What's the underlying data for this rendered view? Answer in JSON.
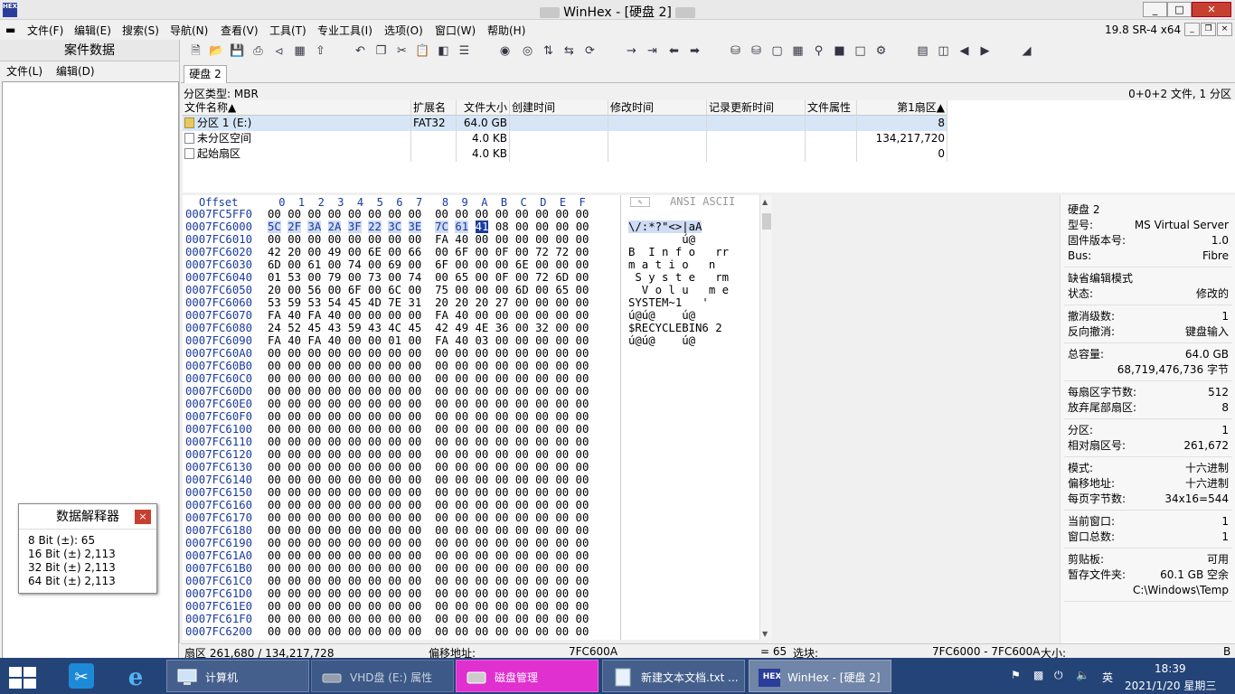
{
  "window": {
    "logo_text": "HEX",
    "title": "WinHex - [硬盘 2]",
    "btn_min": "_",
    "btn_max": "□",
    "btn_close": "✕",
    "mdi_btn_min": "_",
    "mdi_btn_restore": "❐",
    "mdi_btn_close": "×"
  },
  "menu": {
    "items": [
      "文件(F)",
      "编辑(E)",
      "搜索(S)",
      "导航(N)",
      "查看(V)",
      "工具(T)",
      "专业工具(I)",
      "选项(O)",
      "窗口(W)",
      "帮助(H)"
    ],
    "version": "19.8 SR-4 x64"
  },
  "left_panel": {
    "title": "案件数据",
    "menu_file": "文件(L)",
    "menu_edit": "编辑(D)"
  },
  "interpreter": {
    "title": "数据解释器",
    "close": "×",
    "rows": [
      "8 Bit (±): 65",
      "16 Bit (±) 2,113",
      "32 Bit (±) 2,113",
      "64 Bit (±) 2,113"
    ]
  },
  "tab": {
    "label": "硬盘 2"
  },
  "partition_bar": {
    "left": "分区类型: MBR",
    "right": "0+0+2 文件, 1 分区"
  },
  "file_list": {
    "columns": [
      "文件名称▲",
      "扩展名",
      "文件大小",
      "创建时间",
      "修改时间",
      "记录更新时间",
      "文件属性",
      "第1扇区▲"
    ],
    "rows": [
      {
        "name": "分区 1 (E:)",
        "ext": "FAT32",
        "size": "64.0 GB",
        "sector": "8",
        "icon": "partition-folder-icon"
      },
      {
        "name": "未分区空间",
        "ext": "",
        "size": "4.0 KB",
        "sector": "134,217,720",
        "icon": "file-icon"
      },
      {
        "name": "起始扇区",
        "ext": "",
        "size": "4.0 KB",
        "sector": "0",
        "icon": "file-icon"
      }
    ]
  },
  "hex": {
    "header_offset": "Offset",
    "header_cols": " 0  1  2  3  4  5  6  7   8  9  A  B  C  D  E  F",
    "rows": [
      {
        "off": "0007FC5FF0",
        "bytes": "00 00 00 00 00 00 00 00  00 00 00 00 00 00 00 00"
      },
      {
        "off": "0007FC6000",
        "bytes": "5C 2F 3A 2A 3F 22 3C 3E  7C 61 41 08 00 00 00 00"
      },
      {
        "off": "0007FC6010",
        "bytes": "00 00 00 00 00 00 00 00  FA 40 00 00 00 00 00 00"
      },
      {
        "off": "0007FC6020",
        "bytes": "42 20 00 49 00 6E 00 66  00 6F 00 0F 00 72 72 00"
      },
      {
        "off": "0007FC6030",
        "bytes": "6D 00 61 00 74 00 69 00  6F 00 00 00 6E 00 00 00"
      },
      {
        "off": "0007FC6040",
        "bytes": "01 53 00 79 00 73 00 74  00 65 00 0F 00 72 6D 00"
      },
      {
        "off": "0007FC6050",
        "bytes": "20 00 56 00 6F 00 6C 00  75 00 00 00 6D 00 65 00"
      },
      {
        "off": "0007FC6060",
        "bytes": "53 59 53 54 45 4D 7E 31  20 20 20 27 00 00 00 00"
      },
      {
        "off": "0007FC6070",
        "bytes": "FA 40 FA 40 00 00 00 00  FA 40 00 00 00 00 00 00"
      },
      {
        "off": "0007FC6080",
        "bytes": "24 52 45 43 59 43 4C 45  42 49 4E 36 00 32 00 00"
      },
      {
        "off": "0007FC6090",
        "bytes": "FA 40 FA 40 00 00 01 00  FA 40 03 00 00 00 00 00"
      },
      {
        "off": "0007FC60A0",
        "bytes": "00 00 00 00 00 00 00 00  00 00 00 00 00 00 00 00"
      },
      {
        "off": "0007FC60B0",
        "bytes": "00 00 00 00 00 00 00 00  00 00 00 00 00 00 00 00"
      },
      {
        "off": "0007FC60C0",
        "bytes": "00 00 00 00 00 00 00 00  00 00 00 00 00 00 00 00"
      },
      {
        "off": "0007FC60D0",
        "bytes": "00 00 00 00 00 00 00 00  00 00 00 00 00 00 00 00"
      },
      {
        "off": "0007FC60E0",
        "bytes": "00 00 00 00 00 00 00 00  00 00 00 00 00 00 00 00"
      },
      {
        "off": "0007FC60F0",
        "bytes": "00 00 00 00 00 00 00 00  00 00 00 00 00 00 00 00"
      },
      {
        "off": "0007FC6100",
        "bytes": "00 00 00 00 00 00 00 00  00 00 00 00 00 00 00 00"
      },
      {
        "off": "0007FC6110",
        "bytes": "00 00 00 00 00 00 00 00  00 00 00 00 00 00 00 00"
      },
      {
        "off": "0007FC6120",
        "bytes": "00 00 00 00 00 00 00 00  00 00 00 00 00 00 00 00"
      },
      {
        "off": "0007FC6130",
        "bytes": "00 00 00 00 00 00 00 00  00 00 00 00 00 00 00 00"
      },
      {
        "off": "0007FC6140",
        "bytes": "00 00 00 00 00 00 00 00  00 00 00 00 00 00 00 00"
      },
      {
        "off": "0007FC6150",
        "bytes": "00 00 00 00 00 00 00 00  00 00 00 00 00 00 00 00"
      },
      {
        "off": "0007FC6160",
        "bytes": "00 00 00 00 00 00 00 00  00 00 00 00 00 00 00 00"
      },
      {
        "off": "0007FC6170",
        "bytes": "00 00 00 00 00 00 00 00  00 00 00 00 00 00 00 00"
      },
      {
        "off": "0007FC6180",
        "bytes": "00 00 00 00 00 00 00 00  00 00 00 00 00 00 00 00"
      },
      {
        "off": "0007FC6190",
        "bytes": "00 00 00 00 00 00 00 00  00 00 00 00 00 00 00 00"
      },
      {
        "off": "0007FC61A0",
        "bytes": "00 00 00 00 00 00 00 00  00 00 00 00 00 00 00 00"
      },
      {
        "off": "0007FC61B0",
        "bytes": "00 00 00 00 00 00 00 00  00 00 00 00 00 00 00 00"
      },
      {
        "off": "0007FC61C0",
        "bytes": "00 00 00 00 00 00 00 00  00 00 00 00 00 00 00 00"
      },
      {
        "off": "0007FC61D0",
        "bytes": "00 00 00 00 00 00 00 00  00 00 00 00 00 00 00 00"
      },
      {
        "off": "0007FC61E0",
        "bytes": "00 00 00 00 00 00 00 00  00 00 00 00 00 00 00 00"
      },
      {
        "off": "0007FC61F0",
        "bytes": "00 00 00 00 00 00 00 00  00 00 00 00 00 00 00 00"
      },
      {
        "off": "0007FC6200",
        "bytes": "00 00 00 00 00 00 00 00  00 00 00 00 00 00 00 00"
      }
    ],
    "highlight_row": 1,
    "cursor_byte": 10
  },
  "ascii": {
    "header": "ANSI ASCII",
    "rows": [
      "",
      "\\/:*?\"<>|aA",
      "        ú@",
      "B  I n f o   rr",
      "m a t i o   n",
      " S y s t e   rm",
      "  V o l u   m e",
      "SYSTEM~1   '",
      "ú@ú@    ú@",
      "$RECYCLEBIN6 2",
      "ú@ú@    ú@"
    ]
  },
  "info_panel": {
    "groups": [
      [
        {
          "k": "硬盘 2",
          "v": ""
        },
        {
          "k": "型号:",
          "v": "MS Virtual Server"
        },
        {
          "k": "固件版本号:",
          "v": "1.0"
        },
        {
          "k": "Bus:",
          "v": "Fibre"
        }
      ],
      [
        {
          "k": "缺省编辑模式",
          "v": ""
        },
        {
          "k": "状态:",
          "v": "修改的"
        }
      ],
      [
        {
          "k": "撤消级数:",
          "v": "1"
        },
        {
          "k": "反向撤消:",
          "v": "键盘输入"
        }
      ],
      [
        {
          "k": "总容量:",
          "v": "64.0 GB"
        },
        {
          "k": "",
          "v": "68,719,476,736 字节"
        }
      ],
      [
        {
          "k": "每扇区字节数:",
          "v": "512"
        },
        {
          "k": "放弃尾部扇区:",
          "v": "8"
        }
      ],
      [
        {
          "k": "分区:",
          "v": "1"
        },
        {
          "k": "相对扇区号:",
          "v": "261,672"
        }
      ],
      [
        {
          "k": "模式:",
          "v": "十六进制"
        },
        {
          "k": "偏移地址:",
          "v": "十六进制"
        },
        {
          "k": "每页字节数:",
          "v": "34x16=544"
        }
      ],
      [
        {
          "k": "当前窗口:",
          "v": "1"
        },
        {
          "k": "窗口总数:",
          "v": "1"
        }
      ],
      [
        {
          "k": "剪贴板:",
          "v": "可用"
        },
        {
          "k": "暂存文件夹:",
          "v": "60.1 GB 空余"
        },
        {
          "k": "",
          "v": "C:\\Windows\\Temp"
        }
      ]
    ]
  },
  "status": {
    "sector": "扇区 261,680 / 134,217,728",
    "offset_label": "偏移地址:",
    "offset_value": "7FC600A",
    "value": "= 65",
    "selection_label": "选块:",
    "selection_value": "7FC6000 - 7FC600A",
    "size_label": "大小:",
    "size_value": "B"
  },
  "taskbar": {
    "tasks": [
      {
        "label": "计算机",
        "icon": "computer-icon"
      },
      {
        "label": "VHD盘 (E:) 属性",
        "icon": "drive-icon"
      },
      {
        "label": "磁盘管理",
        "icon": "disk-management-icon"
      },
      {
        "label": "新建文本文档.txt ...",
        "icon": "notepad-icon"
      },
      {
        "label": "WinHex - [硬盘 2]",
        "icon": "winhex-icon"
      }
    ],
    "ime": "英",
    "time": "18:39",
    "date": "2021/1/20 星期三"
  },
  "colors": {
    "taskbar": "#244478",
    "highlight": "#cfdcf3",
    "offset_blue": "#1a3aa0",
    "close_red": "#c7402f"
  }
}
